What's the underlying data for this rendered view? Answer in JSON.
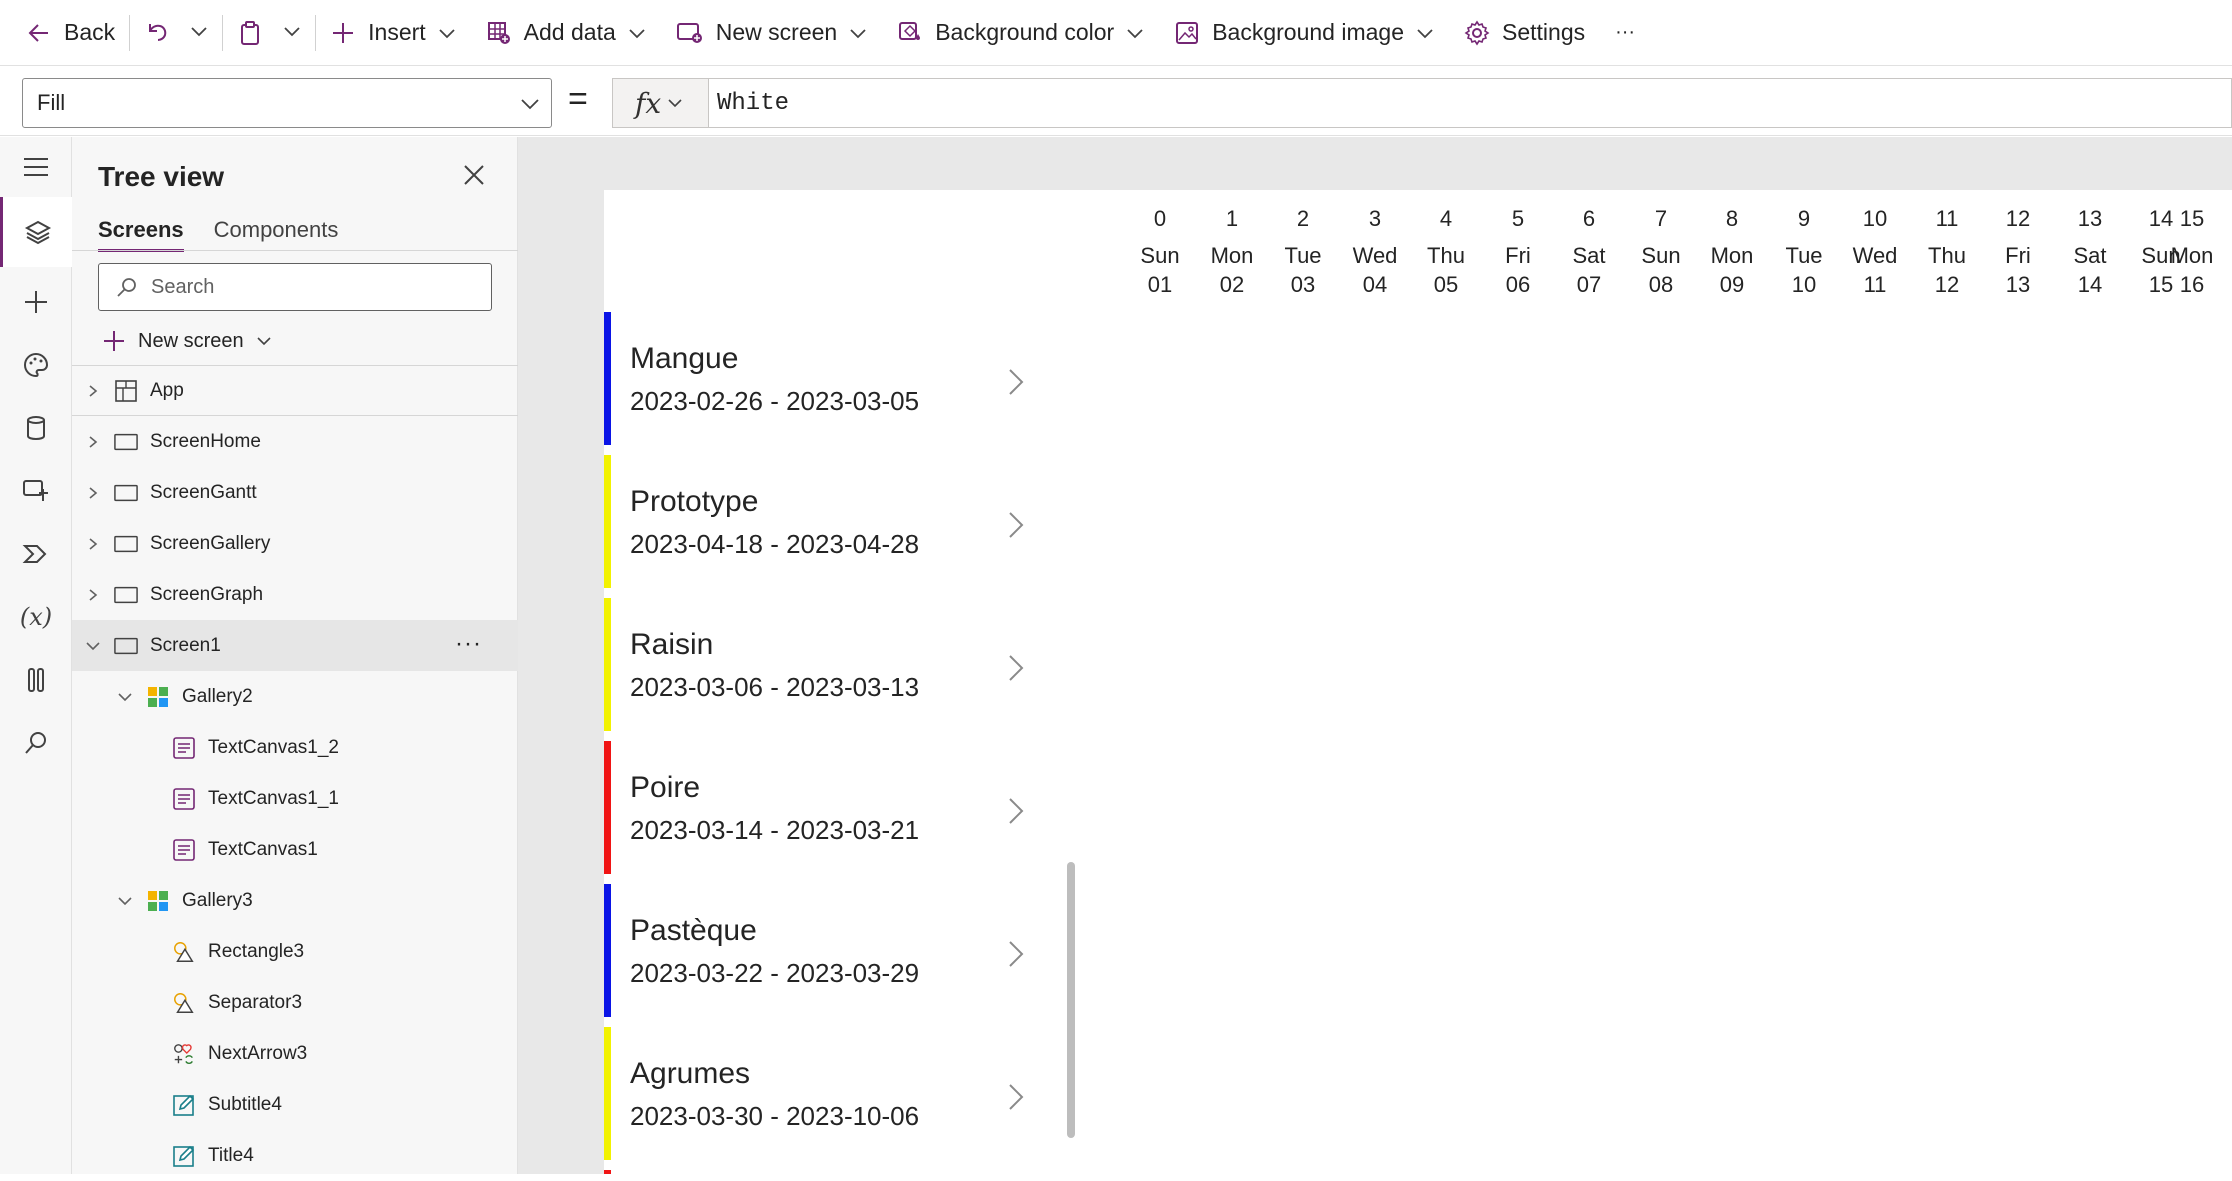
{
  "toolbar": {
    "back": "Back",
    "insert": "Insert",
    "add_data": "Add data",
    "new_screen": "New screen",
    "background_color": "Background color",
    "background_image": "Background image",
    "settings": "Settings",
    "more": "···"
  },
  "formula_bar": {
    "property": "Fill",
    "equals": "=",
    "fx": "fx",
    "formula": "White"
  },
  "tree_view": {
    "title": "Tree view",
    "tabs": [
      "Screens",
      "Components"
    ],
    "search_placeholder": "Search",
    "new_screen": "New screen",
    "items": [
      {
        "label": "App",
        "type": "app"
      },
      {
        "label": "ScreenHome",
        "type": "screen"
      },
      {
        "label": "ScreenGantt",
        "type": "screen"
      },
      {
        "label": "ScreenGallery",
        "type": "screen"
      },
      {
        "label": "ScreenGraph",
        "type": "screen"
      },
      {
        "label": "Screen1",
        "type": "screen",
        "selected": true,
        "more": "···"
      },
      {
        "label": "Gallery2",
        "type": "gallery"
      },
      {
        "label": "TextCanvas1_2",
        "type": "text"
      },
      {
        "label": "TextCanvas1_1",
        "type": "text"
      },
      {
        "label": "TextCanvas1",
        "type": "text"
      },
      {
        "label": "Gallery3",
        "type": "gallery"
      },
      {
        "label": "Rectangle3",
        "type": "shape"
      },
      {
        "label": "Separator3",
        "type": "shape"
      },
      {
        "label": "NextArrow3",
        "type": "icon"
      },
      {
        "label": "Subtitle4",
        "type": "edit"
      },
      {
        "label": "Title4",
        "type": "edit"
      }
    ]
  },
  "calendar": {
    "days": [
      {
        "index": "0",
        "weekday": "Sun",
        "date": "01"
      },
      {
        "index": "1",
        "weekday": "Mon",
        "date": "02"
      },
      {
        "index": "2",
        "weekday": "Tue",
        "date": "03"
      },
      {
        "index": "3",
        "weekday": "Wed",
        "date": "04"
      },
      {
        "index": "4",
        "weekday": "Thu",
        "date": "05"
      },
      {
        "index": "5",
        "weekday": "Fri",
        "date": "06"
      },
      {
        "index": "6",
        "weekday": "Sat",
        "date": "07"
      },
      {
        "index": "7",
        "weekday": "Sun",
        "date": "08"
      },
      {
        "index": "8",
        "weekday": "Mon",
        "date": "09"
      },
      {
        "index": "9",
        "weekday": "Tue",
        "date": "10"
      },
      {
        "index": "10",
        "weekday": "Wed",
        "date": "11"
      },
      {
        "index": "11",
        "weekday": "Thu",
        "date": "12"
      },
      {
        "index": "12",
        "weekday": "Fri",
        "date": "13"
      },
      {
        "index": "13",
        "weekday": "Sat",
        "date": "14"
      },
      {
        "index": "14",
        "weekday": "Sun",
        "date": "15"
      },
      {
        "index": "15",
        "weekday": "Mon",
        "date": "16"
      }
    ]
  },
  "gallery": {
    "items": [
      {
        "title": "Mangue",
        "dates": "2023-02-26 - 2023-03-05",
        "color": "#0a14e6"
      },
      {
        "title": "Prototype",
        "dates": "2023-04-18 - 2023-04-28",
        "color": "#f2f200"
      },
      {
        "title": "Raisin",
        "dates": "2023-03-06 - 2023-03-13",
        "color": "#f2f200"
      },
      {
        "title": "Poire",
        "dates": "2023-03-14 - 2023-03-21",
        "color": "#f01414"
      },
      {
        "title": "Pastèque",
        "dates": "2023-03-22 - 2023-03-29",
        "color": "#0a14e6"
      },
      {
        "title": "Agrumes",
        "dates": "2023-03-30 - 2023-10-06",
        "color": "#f2f200"
      }
    ]
  },
  "colors": {
    "accent": "#742774",
    "canvas_bg": "#e8e8e8",
    "panel_bg": "#f7f7f7"
  }
}
